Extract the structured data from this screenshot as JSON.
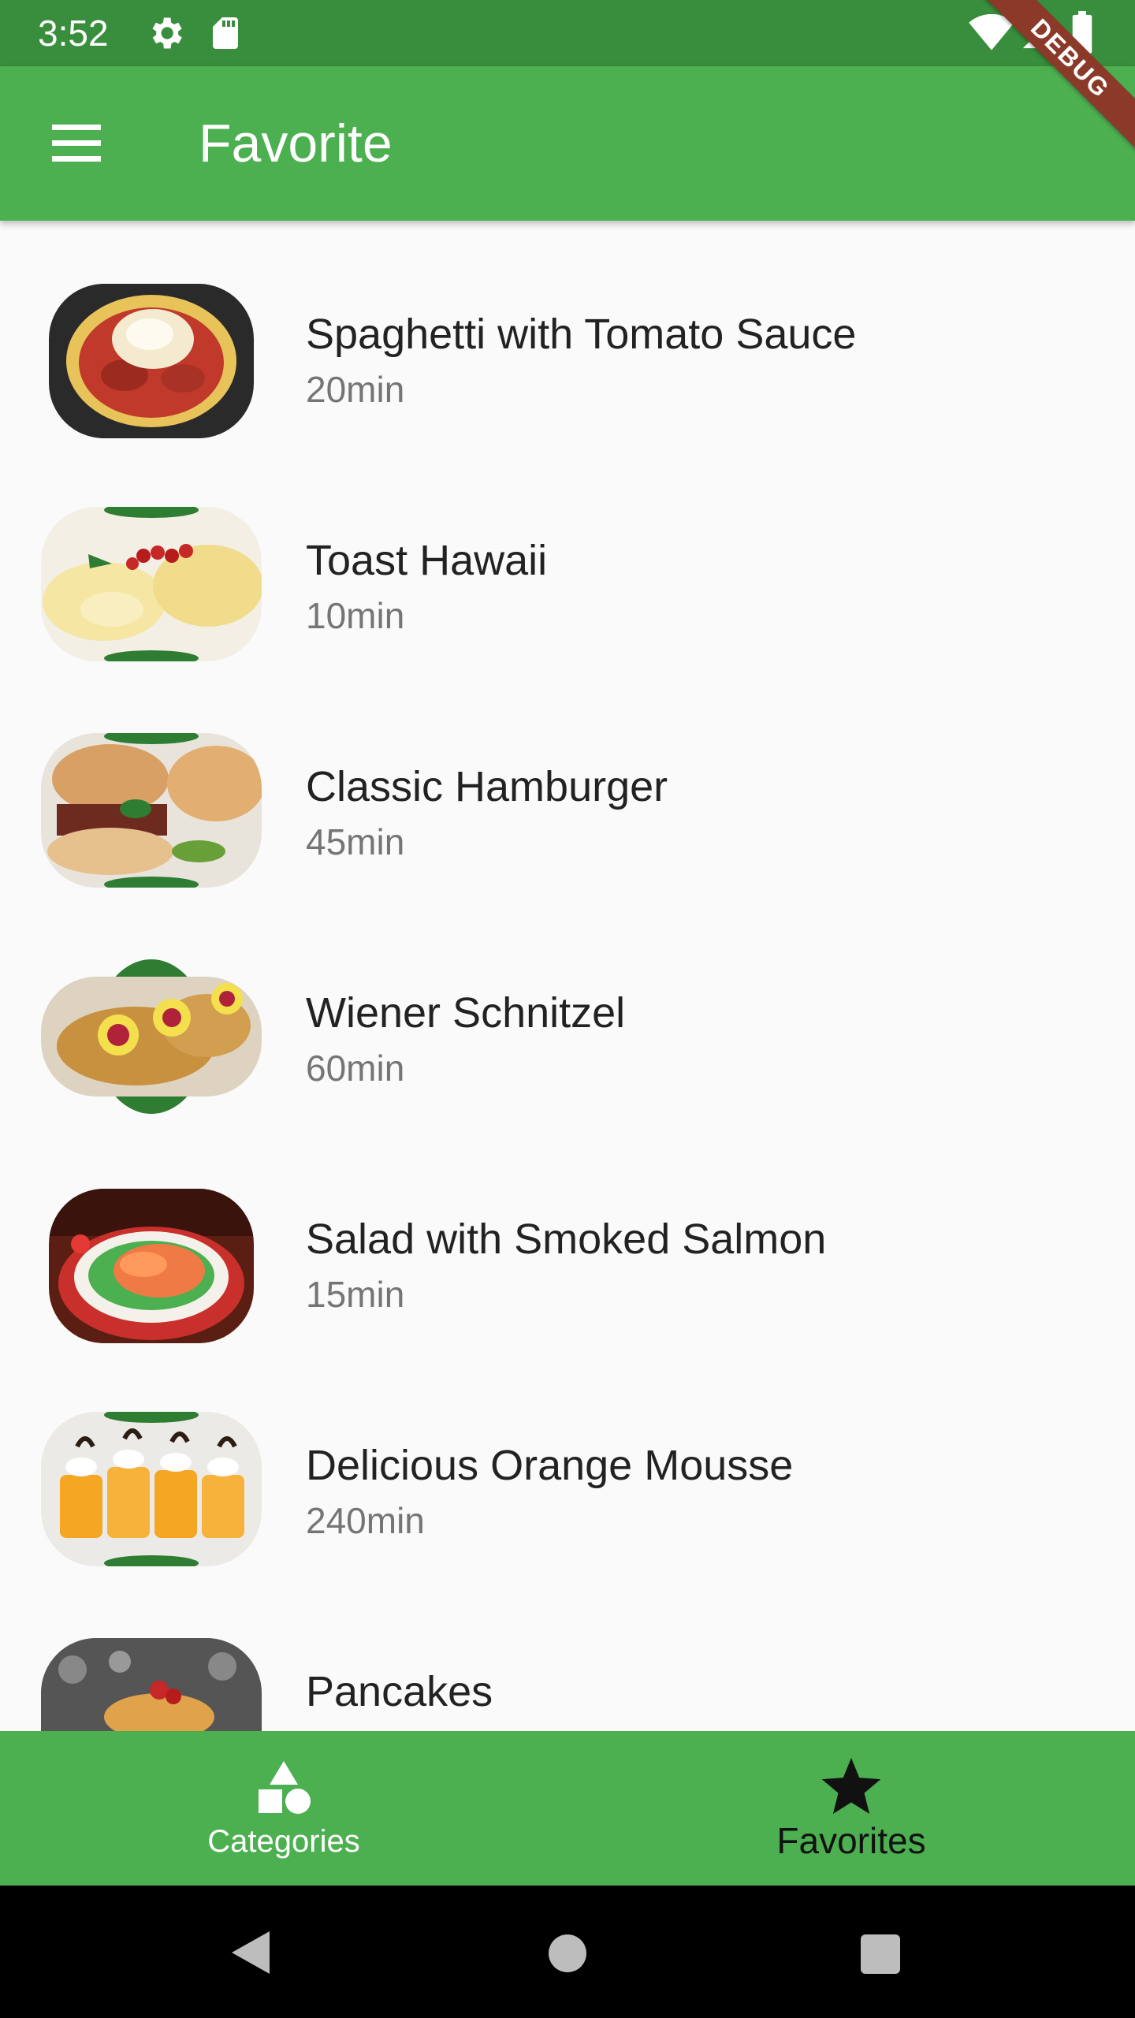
{
  "status_bar": {
    "time": "3:52",
    "icons": [
      "gear-icon",
      "sd-card-icon",
      "wifi-icon",
      "signal-icon",
      "battery-icon"
    ],
    "debug_label": "DEBUG"
  },
  "app_bar": {
    "title": "Favorite",
    "menu_icon": "hamburger-menu-icon",
    "color": "#4caf50"
  },
  "meals": [
    {
      "title": "Spaghetti with Tomato Sauce",
      "duration": "20min"
    },
    {
      "title": "Toast Hawaii",
      "duration": "10min"
    },
    {
      "title": "Classic Hamburger",
      "duration": "45min"
    },
    {
      "title": "Wiener Schnitzel",
      "duration": "60min"
    },
    {
      "title": "Salad with Smoked Salmon",
      "duration": "15min"
    },
    {
      "title": "Delicious Orange Mousse",
      "duration": "240min"
    },
    {
      "title": "Pancakes",
      "duration": ""
    }
  ],
  "bottom_nav": {
    "tabs": [
      {
        "label": "Categories",
        "icon": "category-shapes-icon",
        "active": false
      },
      {
        "label": "Favorites",
        "icon": "star-icon",
        "active": true
      }
    ]
  },
  "system_nav": {
    "icons": [
      "back-icon",
      "home-icon",
      "recents-icon"
    ]
  },
  "colors": {
    "primary": "#4caf50",
    "primary_dark": "#388e3c",
    "background": "#fafafa"
  }
}
